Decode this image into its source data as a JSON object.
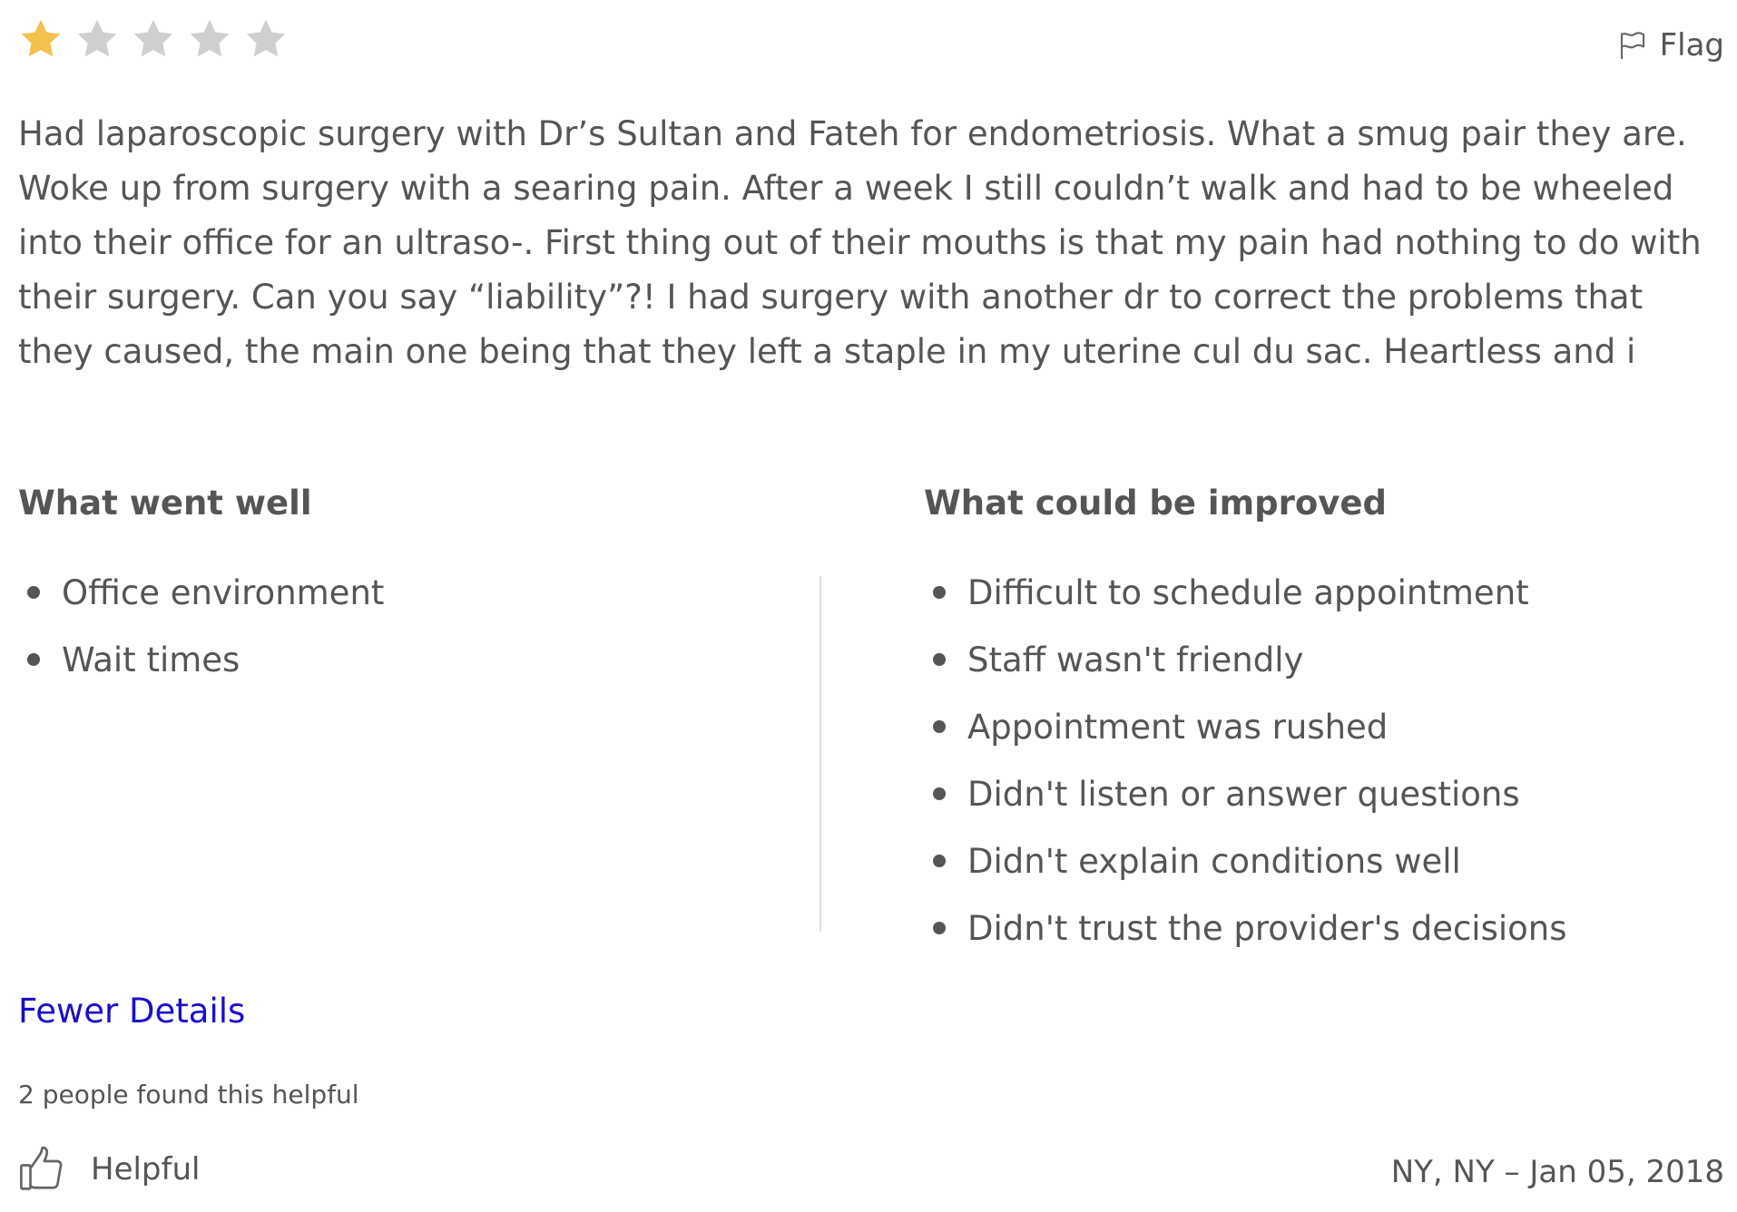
{
  "rating": {
    "value": 1,
    "max": 5,
    "filled_color": "#f2c14e",
    "empty_color": "#cfcfcf"
  },
  "flag": {
    "label": "Flag",
    "icon": "flag-icon"
  },
  "review": {
    "text": "Had laparoscopic surgery with Dr’s Sultan and Fateh for endometriosis. What a smug pair they are. Woke up from surgery with a searing pain. After a week I still couldn’t walk and had to be wheeled into their office for an ultraso-. First thing out of their mouths is that my pain had nothing to do with their surgery. Can you say “liability”?! I had surgery with another dr to correct the problems that they caused, the main one being that they left a staple in my uterine cul du sac. Heartless and i"
  },
  "went_well": {
    "heading": "What went well",
    "items": [
      "Office environment",
      "Wait times"
    ]
  },
  "could_improve": {
    "heading": "What could be improved",
    "items": [
      "Difficult to schedule appointment",
      "Staff wasn't friendly",
      "Appointment was rushed",
      "Didn't listen or answer questions",
      "Didn't explain conditions well",
      "Didn't trust the provider's decisions"
    ]
  },
  "details_toggle": {
    "label": "Fewer Details",
    "color": "#1a0dcc"
  },
  "helpful": {
    "count_text": "2 people found this helpful",
    "button_label": "Helpful",
    "icon": "thumbs-up-icon"
  },
  "meta": {
    "location_date": "NY, NY – Jan 05, 2018"
  }
}
